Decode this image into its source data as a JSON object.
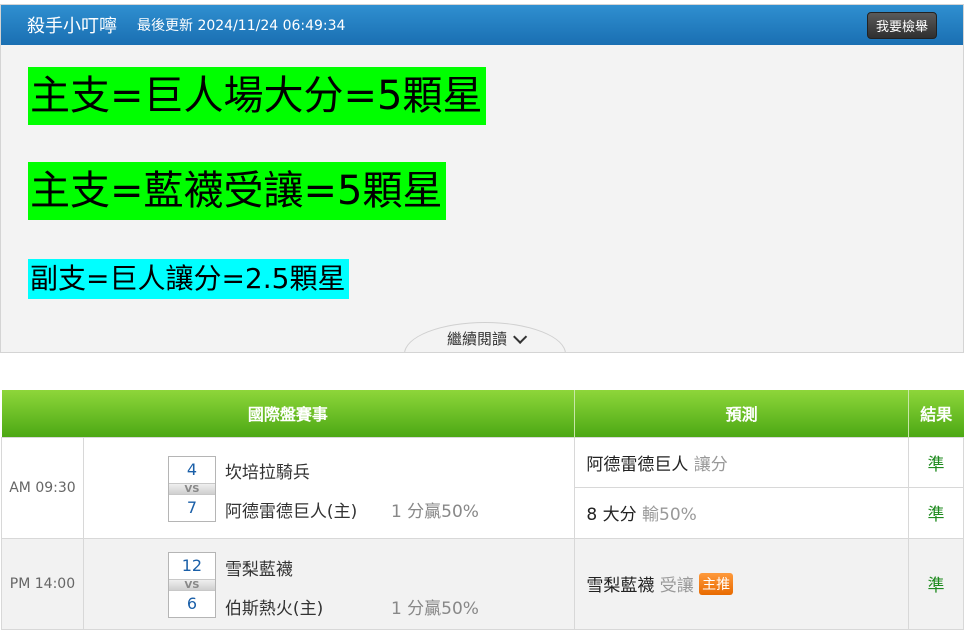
{
  "post": {
    "author": "殺手小叮嚀",
    "updated": "最後更新 2024/11/24 06:49:34",
    "report_button": "我要檢舉",
    "picks": [
      "主支=巨人場大分=5顆星",
      "主支=藍襪受讓=5顆星",
      "副支=巨人讓分=2.5顆星"
    ],
    "pick_colors": [
      "#00ff00",
      "#00ff00",
      "#00ffff"
    ],
    "read_more": "繼續閱讀",
    "read_more_icon": "chevron-down-icon"
  },
  "table": {
    "headers": [
      "國際盤賽事",
      "預測",
      "結果"
    ],
    "rows": [
      {
        "time": "AM 09:30",
        "away_score": "4",
        "vs": "VS",
        "home_score": "7",
        "away_team": "坎培拉騎兵",
        "home_team": "阿德雷德巨人(主)",
        "handicap": "1 分贏50%",
        "predictions": [
          {
            "pick": "阿德雷德巨人",
            "type": "讓分",
            "result": "準"
          },
          {
            "pick": "8 大分",
            "type": "輸50%",
            "result": "準"
          }
        ]
      },
      {
        "time": "PM 14:00",
        "away_score": "12",
        "vs": "VS",
        "home_score": "6",
        "away_team": "雪梨藍襪",
        "home_team": "伯斯熱火(主)",
        "handicap": "1 分贏50%",
        "predictions": [
          {
            "pick": "雪梨藍襪",
            "type": "受讓",
            "badge": "主推",
            "result": "準"
          }
        ]
      }
    ]
  },
  "colors": {
    "header_blue": "#1a6fb2",
    "table_header_green": "#4ca814",
    "result_green": "#1e8a1e",
    "badge_orange": "#e86a00"
  }
}
